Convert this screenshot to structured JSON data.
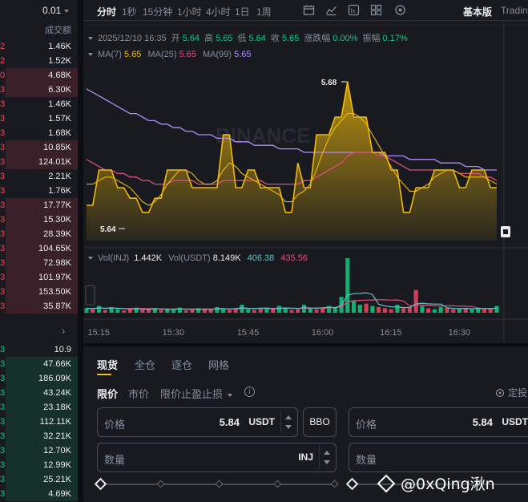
{
  "orderbook": {
    "precision": "0.01",
    "column_label": "成交额",
    "asks": [
      {
        "left": "2",
        "value": "1.46K",
        "depth": 0.0
      },
      {
        "left": "2",
        "value": "1.52K",
        "depth": 0.0
      },
      {
        "left": "0",
        "value": "4.68K",
        "depth": 0.93
      },
      {
        "left": "3",
        "value": "6.30K",
        "depth": 0.93
      },
      {
        "left": "3",
        "value": "1.46K",
        "depth": 0.0
      },
      {
        "left": "3",
        "value": "1.57K",
        "depth": 0.0
      },
      {
        "left": "3",
        "value": "1.68K",
        "depth": 0.0
      },
      {
        "left": "3",
        "value": "10.85K",
        "depth": 0.93
      },
      {
        "left": "3",
        "value": "124.01K",
        "depth": 0.93
      },
      {
        "left": "3",
        "value": "2.21K",
        "depth": 0.0
      },
      {
        "left": "3",
        "value": "1.76K",
        "depth": 0.0
      },
      {
        "left": "3",
        "value": "17.77K",
        "depth": 0.93
      },
      {
        "left": "3",
        "value": "15.30K",
        "depth": 0.93
      },
      {
        "left": "3",
        "value": "28.39K",
        "depth": 0.93
      },
      {
        "left": "3",
        "value": "104.65K",
        "depth": 0.93
      },
      {
        "left": "3",
        "value": "72.98K",
        "depth": 0.93
      },
      {
        "left": "3",
        "value": "101.97K",
        "depth": 0.93
      },
      {
        "left": "3",
        "value": "153.50K",
        "depth": 0.93
      },
      {
        "left": "3",
        "value": "35.87K",
        "depth": 0.93
      }
    ],
    "mid_arrow": "›",
    "bids": [
      {
        "left": "3",
        "value": "10.9",
        "depth": 0.0
      },
      {
        "left": "3",
        "value": "47.66K",
        "depth": 0.93
      },
      {
        "left": "3",
        "value": "186.09K",
        "depth": 0.93
      },
      {
        "left": "3",
        "value": "43.24K",
        "depth": 0.93
      },
      {
        "left": "3",
        "value": "23.18K",
        "depth": 0.93
      },
      {
        "left": "3",
        "value": "112.11K",
        "depth": 0.93
      },
      {
        "left": "3",
        "value": "32.21K",
        "depth": 0.93
      },
      {
        "left": "3",
        "value": "12.70K",
        "depth": 0.93
      },
      {
        "left": "3",
        "value": "12.99K",
        "depth": 0.93
      },
      {
        "left": "3",
        "value": "25.21K",
        "depth": 0.93
      },
      {
        "left": "3",
        "value": "4.69K",
        "depth": 0.93
      }
    ]
  },
  "chart": {
    "timeframes": [
      "分时",
      "1秒",
      "15分钟",
      "1小时",
      "4小时",
      "1日",
      "1周"
    ],
    "active_timeframe": "分时",
    "toolbar_icons": [
      "calendar-icon",
      "line-draw-icon",
      "indicator-icon",
      "layout-icon",
      "settings-icon"
    ],
    "version_basic": "基本版",
    "version_tv": "TradingView",
    "info": {
      "date": "2025/12/10 16:35",
      "open_label": "开",
      "open": "5.64",
      "high_label": "高",
      "high": "5.65",
      "low_label": "低",
      "low": "5.64",
      "close_label": "收",
      "close": "5.65",
      "change_label": "涨跌幅",
      "change": "0.00%",
      "amp_label": "振幅",
      "amp": "0.17%"
    },
    "ma": {
      "ma7_label": "MA(7)",
      "ma7": "5.65",
      "ma25_label": "MA(25)",
      "ma25": "5.65",
      "ma99_label": "MA(99)",
      "ma99": "5.65"
    },
    "high_marker": "5.68",
    "low_marker": "5.64",
    "watermark_text": "BINANCE",
    "vol": {
      "label1": "Vol(INJ)",
      "val1": "1.442K",
      "label2": "Vol(USDT)",
      "val2": "8.149K",
      "val3": "406.38",
      "val4": "435.56"
    },
    "time_ticks": [
      "15:15",
      "15:30",
      "15:45",
      "16:00",
      "16:15",
      "16:30"
    ],
    "colors": {
      "price": "#f0b90b",
      "ma25": "#e04d7f",
      "ma99": "#b18cfe",
      "up": "#0ecb81",
      "down": "#f6465d"
    }
  },
  "chart_data": {
    "type": "area",
    "title": "",
    "x_ticks": [
      "15:15",
      "15:30",
      "15:45",
      "16:00",
      "16:15",
      "16:30"
    ],
    "ylim": [
      5.635,
      5.685
    ],
    "series": [
      {
        "values": [
          5.645,
          5.645,
          5.655,
          5.655,
          5.655,
          5.65,
          5.65,
          5.647,
          5.647,
          5.643,
          5.643,
          5.647,
          5.647,
          5.655,
          5.655,
          5.655,
          5.655,
          5.65,
          5.65,
          5.65,
          5.65,
          5.65,
          5.665,
          5.665,
          5.65,
          5.65,
          5.655,
          5.655,
          5.65,
          5.65,
          5.65,
          5.65,
          5.643,
          5.643,
          5.657,
          5.65,
          5.65,
          5.665,
          5.665,
          5.665,
          5.67,
          5.67,
          5.68,
          5.67,
          5.67,
          5.67,
          5.66,
          5.66,
          5.66,
          5.655,
          5.655,
          5.643,
          5.643,
          5.65,
          5.65,
          5.65,
          5.655,
          5.655,
          5.655,
          5.655,
          5.65,
          5.65,
          5.655,
          5.655,
          5.655,
          5.65,
          5.65
        ]
      },
      {
        "name": "MA(7)",
        "values": [
          5.651,
          5.651,
          5.652,
          5.653,
          5.653,
          5.652,
          5.651,
          5.65,
          5.648,
          5.646,
          5.645,
          5.646,
          5.648,
          5.651,
          5.653,
          5.655,
          5.655,
          5.654,
          5.652,
          5.651,
          5.651,
          5.652,
          5.655,
          5.657,
          5.656,
          5.654,
          5.653,
          5.652,
          5.651,
          5.65,
          5.649,
          5.648,
          5.646,
          5.646,
          5.648,
          5.649,
          5.651,
          5.655,
          5.66,
          5.664,
          5.667,
          5.669,
          5.671,
          5.671,
          5.67,
          5.668,
          5.665,
          5.662,
          5.659,
          5.656,
          5.653,
          5.651,
          5.649,
          5.649,
          5.65,
          5.651,
          5.653,
          5.654,
          5.655,
          5.655,
          5.654,
          5.653,
          5.653,
          5.653,
          5.653,
          5.652,
          5.651
        ]
      },
      {
        "name": "MA(25)",
        "values": [
          5.658,
          5.657,
          5.656,
          5.655,
          5.655,
          5.654,
          5.654,
          5.653,
          5.653,
          5.652,
          5.652,
          5.651,
          5.651,
          5.651,
          5.652,
          5.652,
          5.652,
          5.652,
          5.651,
          5.651,
          5.651,
          5.651,
          5.652,
          5.652,
          5.652,
          5.652,
          5.652,
          5.652,
          5.652,
          5.651,
          5.651,
          5.651,
          5.651,
          5.651,
          5.651,
          5.652,
          5.652,
          5.653,
          5.654,
          5.655,
          5.656,
          5.657,
          5.659,
          5.66,
          5.66,
          5.66,
          5.66,
          5.659,
          5.659,
          5.658,
          5.657,
          5.656,
          5.655,
          5.655,
          5.655,
          5.655,
          5.655,
          5.655,
          5.655,
          5.655,
          5.654,
          5.654,
          5.654,
          5.654,
          5.653,
          5.653,
          5.652
        ]
      },
      {
        "name": "MA(99)",
        "values": [
          5.678,
          5.677,
          5.676,
          5.675,
          5.674,
          5.673,
          5.672,
          5.671,
          5.671,
          5.67,
          5.669,
          5.669,
          5.668,
          5.668,
          5.667,
          5.667,
          5.666,
          5.666,
          5.665,
          5.665,
          5.665,
          5.664,
          5.664,
          5.664,
          5.663,
          5.663,
          5.663,
          5.662,
          5.662,
          5.662,
          5.662,
          5.661,
          5.661,
          5.661,
          5.661,
          5.66,
          5.66,
          5.66,
          5.66,
          5.66,
          5.66,
          5.66,
          5.66,
          5.66,
          5.66,
          5.66,
          5.66,
          5.66,
          5.659,
          5.659,
          5.659,
          5.659,
          5.658,
          5.658,
          5.658,
          5.658,
          5.658,
          5.657,
          5.657,
          5.657,
          5.657,
          5.656,
          5.656,
          5.656,
          5.655,
          5.655,
          5.655
        ]
      }
    ],
    "volume": [
      8,
      6,
      12,
      5,
      10,
      6,
      4,
      7,
      9,
      5,
      6,
      8,
      5,
      7,
      6,
      9,
      4,
      5,
      8,
      6,
      7,
      10,
      6,
      5,
      8,
      14,
      6,
      5,
      7,
      9,
      6,
      12,
      8,
      5,
      6,
      14,
      9,
      6,
      8,
      12,
      10,
      28,
      96,
      22,
      14,
      16,
      12,
      10,
      8,
      6,
      14,
      8,
      10,
      40,
      12,
      8,
      6,
      10,
      8,
      6,
      7,
      8,
      6,
      9,
      6,
      8,
      12
    ],
    "volume_up": [
      1,
      0,
      1,
      0,
      1,
      1,
      0,
      0,
      1,
      0,
      0,
      1,
      0,
      1,
      1,
      1,
      0,
      0,
      1,
      0,
      0,
      1,
      1,
      0,
      0,
      1,
      1,
      0,
      0,
      1,
      0,
      1,
      1,
      0,
      0,
      1,
      1,
      0,
      0,
      1,
      1,
      1,
      1,
      1,
      1,
      0,
      1,
      0,
      0,
      0,
      1,
      0,
      0,
      0,
      1,
      0,
      1,
      1,
      0,
      0,
      1,
      0,
      1,
      1,
      0,
      0,
      1
    ]
  },
  "form": {
    "tabs": [
      "现货",
      "全仓",
      "逐仓",
      "网格"
    ],
    "active_tab": "现货",
    "price_types": [
      "限价",
      "市价",
      "限价止盈止损"
    ],
    "auto_label": "定投",
    "price_label": "价格",
    "price_value": "5.84",
    "quote_unit": "USDT",
    "bbo_label": "BBO",
    "qty_label": "数量",
    "base_unit": "INJ",
    "price_label_2": "价格",
    "price_value_2": "5.84",
    "quote_unit_2": "USDT",
    "qty_label_2": "数量",
    "slider_percent": 0
  },
  "watermark": "@0xQing湫n"
}
